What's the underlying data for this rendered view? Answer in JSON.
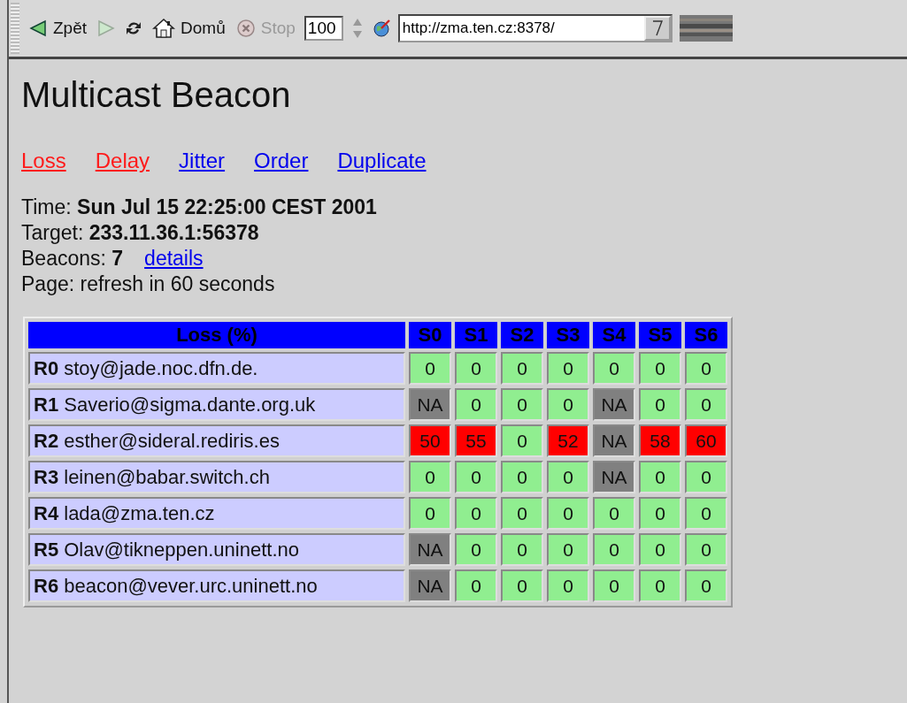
{
  "toolbar": {
    "back": {
      "label": "Zpět",
      "disabled": false
    },
    "forward": {
      "disabled": true
    },
    "home": {
      "label": "Domů"
    },
    "stop": {
      "label": "Stop",
      "disabled": true
    },
    "zoom": "100",
    "url": "http://zma.ten.cz:8378/"
  },
  "title": "Multicast Beacon",
  "nav_links": [
    {
      "label": "Loss",
      "visited": true
    },
    {
      "label": "Delay",
      "visited": true
    },
    {
      "label": "Jitter",
      "visited": false
    },
    {
      "label": "Order",
      "visited": false
    },
    {
      "label": "Duplicate",
      "visited": false
    }
  ],
  "info": [
    {
      "label": "Time:",
      "value": "Sun Jul 15 22:25:00 CEST 2001"
    },
    {
      "label": "Target:",
      "value": "233.11.36.1:56378"
    },
    {
      "label": "Beacons:",
      "value": "7",
      "link": "details"
    },
    {
      "label": "Page: refresh in 60 seconds"
    }
  ],
  "table": {
    "title": "Loss (%)",
    "columns": [
      "S0",
      "S1",
      "S2",
      "S3",
      "S4",
      "S5",
      "S6"
    ],
    "rows": [
      {
        "id": "R0",
        "host": "stoy@jade.noc.dfn.de.",
        "cells": [
          {
            "text": "0",
            "color": "#90ee90"
          },
          {
            "text": "0",
            "color": "#90ee90"
          },
          {
            "text": "0",
            "color": "#90ee90"
          },
          {
            "text": "0",
            "color": "#90ee90"
          },
          {
            "text": "0",
            "color": "#90ee90"
          },
          {
            "text": "0",
            "color": "#90ee90"
          },
          {
            "text": "0",
            "color": "#90ee90"
          }
        ]
      },
      {
        "id": "R1",
        "host": "Saverio@sigma.dante.org.uk",
        "cells": [
          {
            "text": "NA",
            "color": "#808080"
          },
          {
            "text": "0",
            "color": "#90ee90"
          },
          {
            "text": "0",
            "color": "#90ee90"
          },
          {
            "text": "0",
            "color": "#90ee90"
          },
          {
            "text": "NA",
            "color": "#808080"
          },
          {
            "text": "0",
            "color": "#90ee90"
          },
          {
            "text": "0",
            "color": "#90ee90"
          }
        ]
      },
      {
        "id": "R2",
        "host": "esther@sideral.rediris.es",
        "cells": [
          {
            "text": "50",
            "color": "#ff0000"
          },
          {
            "text": "55",
            "color": "#ff0000"
          },
          {
            "text": "0",
            "color": "#90ee90"
          },
          {
            "text": "52",
            "color": "#ff0000"
          },
          {
            "text": "NA",
            "color": "#808080"
          },
          {
            "text": "58",
            "color": "#ff0000"
          },
          {
            "text": "60",
            "color": "#ff0000"
          }
        ]
      },
      {
        "id": "R3",
        "host": "leinen@babar.switch.ch",
        "cells": [
          {
            "text": "0",
            "color": "#90ee90"
          },
          {
            "text": "0",
            "color": "#90ee90"
          },
          {
            "text": "0",
            "color": "#90ee90"
          },
          {
            "text": "0",
            "color": "#90ee90"
          },
          {
            "text": "NA",
            "color": "#808080"
          },
          {
            "text": "0",
            "color": "#90ee90"
          },
          {
            "text": "0",
            "color": "#90ee90"
          }
        ]
      },
      {
        "id": "R4",
        "host": "lada@zma.ten.cz",
        "cells": [
          {
            "text": "0",
            "color": "#90ee90"
          },
          {
            "text": "0",
            "color": "#90ee90"
          },
          {
            "text": "0",
            "color": "#90ee90"
          },
          {
            "text": "0",
            "color": "#90ee90"
          },
          {
            "text": "0",
            "color": "#90ee90"
          },
          {
            "text": "0",
            "color": "#90ee90"
          },
          {
            "text": "0",
            "color": "#90ee90"
          }
        ]
      },
      {
        "id": "R5",
        "host": "Olav@tikneppen.uninett.no",
        "cells": [
          {
            "text": "NA",
            "color": "#808080"
          },
          {
            "text": "0",
            "color": "#90ee90"
          },
          {
            "text": "0",
            "color": "#90ee90"
          },
          {
            "text": "0",
            "color": "#90ee90"
          },
          {
            "text": "0",
            "color": "#90ee90"
          },
          {
            "text": "0",
            "color": "#90ee90"
          },
          {
            "text": "0",
            "color": "#90ee90"
          }
        ]
      },
      {
        "id": "R6",
        "host": "beacon@vever.urc.uninett.no",
        "cells": [
          {
            "text": "NA",
            "color": "#808080"
          },
          {
            "text": "0",
            "color": "#90ee90"
          },
          {
            "text": "0",
            "color": "#90ee90"
          },
          {
            "text": "0",
            "color": "#90ee90"
          },
          {
            "text": "0",
            "color": "#90ee90"
          },
          {
            "text": "0",
            "color": "#90ee90"
          },
          {
            "text": "0",
            "color": "#90ee90"
          }
        ]
      }
    ]
  }
}
